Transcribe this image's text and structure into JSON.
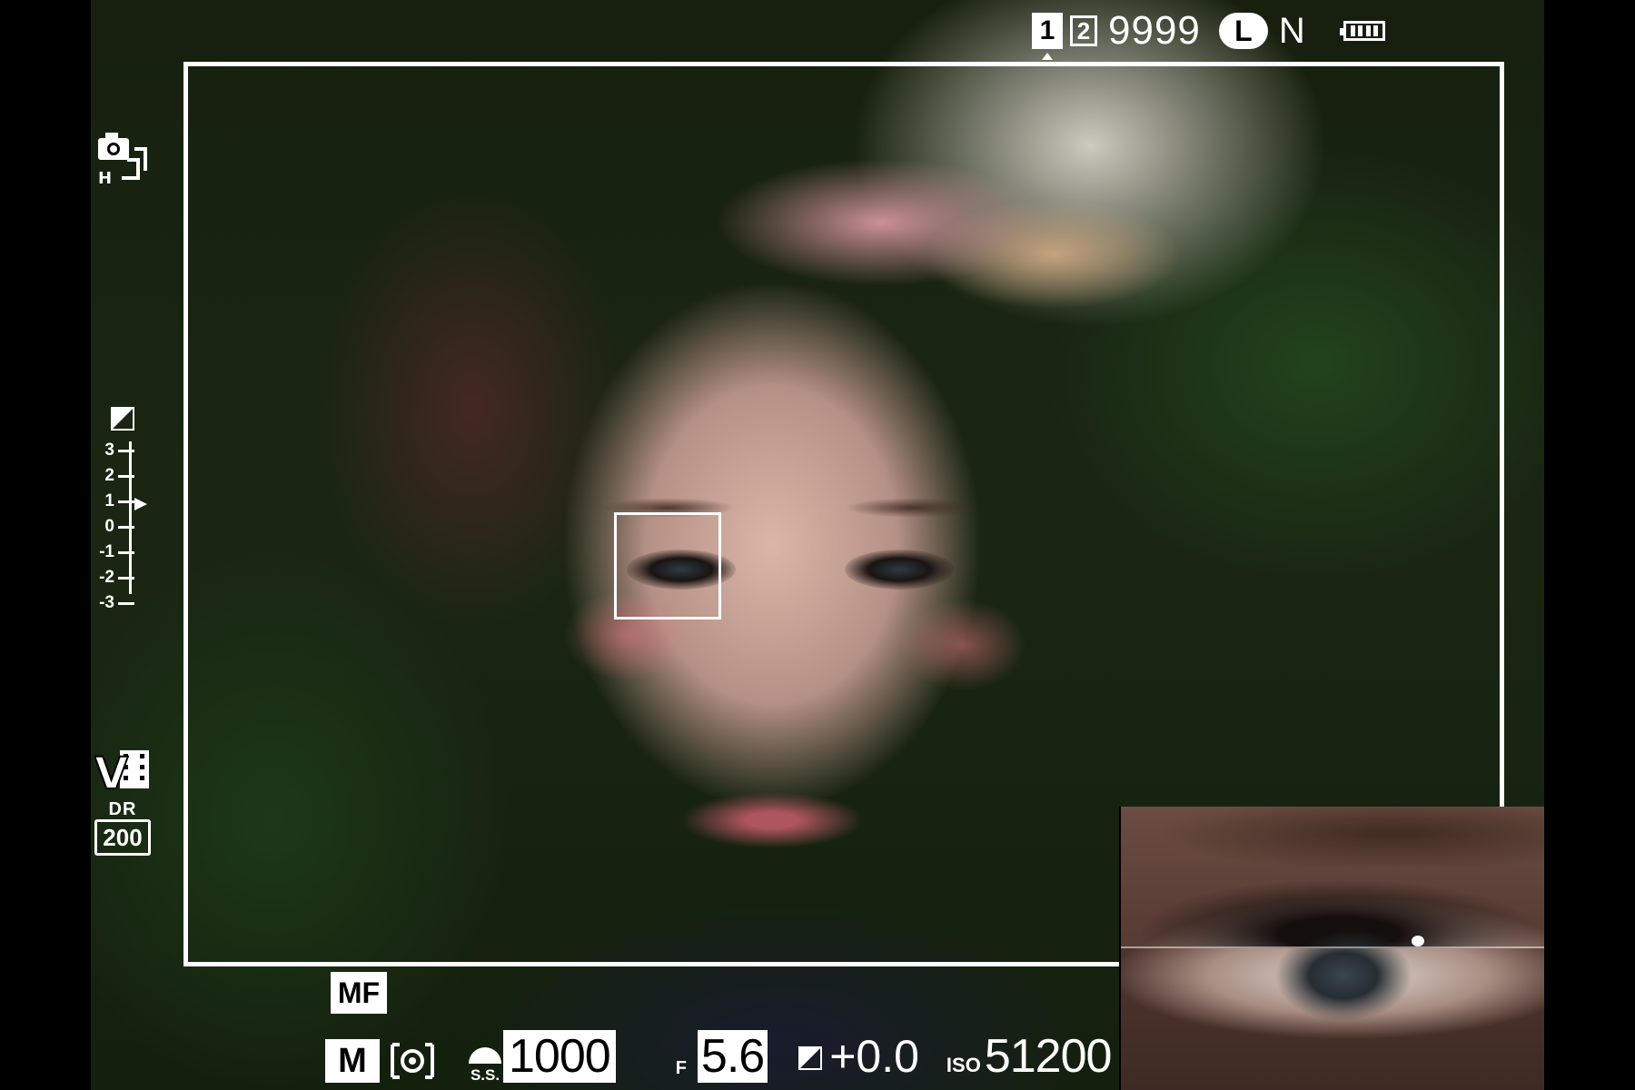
{
  "status": {
    "card_slot_1": "1",
    "card_slot_2": "2",
    "shots_remaining": "9999",
    "image_size": "L",
    "image_quality": "N",
    "battery_level": 1.0
  },
  "left_panel": {
    "drive_mode": "H",
    "exposure_scale_labels": [
      "3",
      "2",
      "1",
      "0",
      "-1",
      "-2",
      "-3"
    ],
    "exposure_indicator_value": 1,
    "film_simulation_letter": "V",
    "dynamic_range_label": "DR",
    "dynamic_range_value": "200"
  },
  "bottom": {
    "focus_mode": "MF",
    "shooting_mode": "M",
    "shutter_label": "S.S.",
    "shutter_speed": "1000",
    "aperture_label": "F",
    "aperture": "5.6",
    "exposure_compensation": "+0.0",
    "iso_label": "ISO",
    "iso": "51200"
  },
  "icons": {
    "drive": "camera-burst-icon",
    "exposure": "exposure-compensation-icon",
    "film": "film-simulation-icon",
    "metering": "multi-metering-icon",
    "battery": "battery-icon"
  },
  "colors": {
    "overlay": "#ffffff",
    "background": "#000000"
  }
}
